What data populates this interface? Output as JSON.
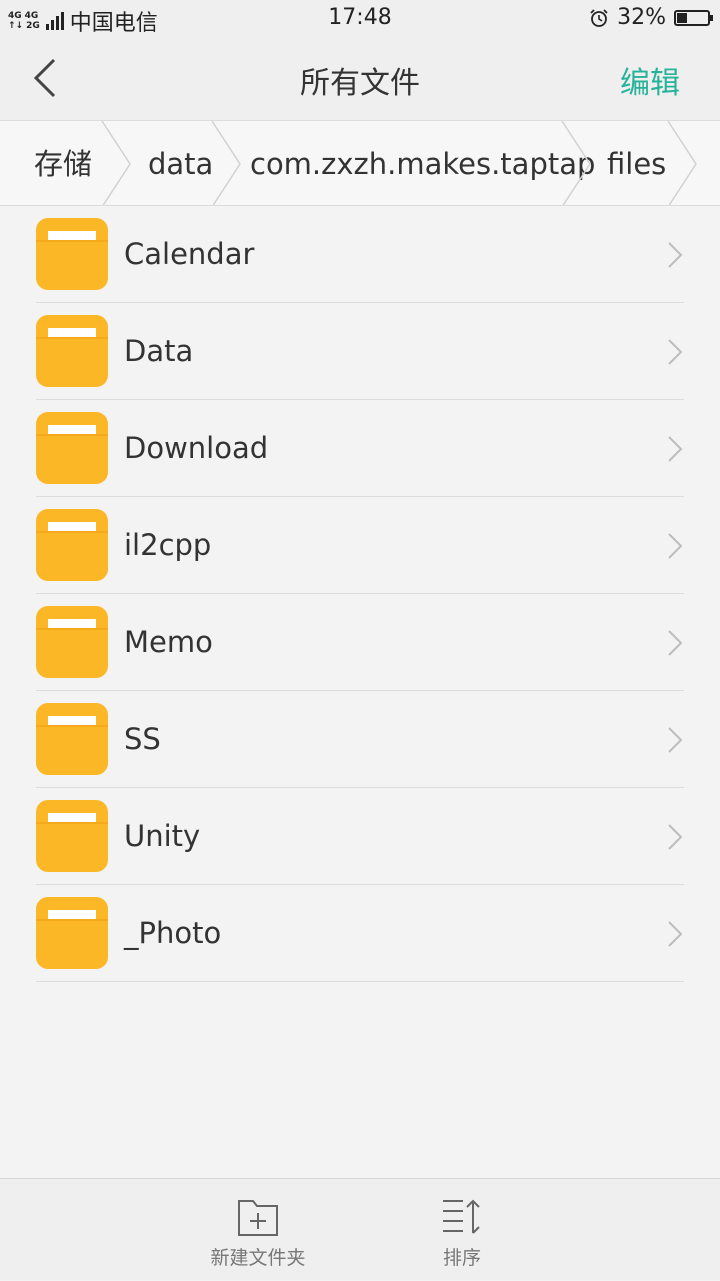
{
  "status_bar": {
    "network_top": [
      "4G",
      "4G"
    ],
    "network_bottom": [
      "↑↓",
      "2G"
    ],
    "carrier": "中国电信",
    "time": "17:48",
    "battery": "32%",
    "battery_level": 0.32
  },
  "header": {
    "title": "所有文件",
    "edit_label": "编辑",
    "back_icon": "back-arrow-icon"
  },
  "breadcrumb": [
    "存储",
    "data",
    "com.zxzh.makes.taptap",
    "files"
  ],
  "folders": [
    {
      "name": "Calendar"
    },
    {
      "name": "Data"
    },
    {
      "name": "Download"
    },
    {
      "name": "il2cpp"
    },
    {
      "name": "Memo"
    },
    {
      "name": "SS"
    },
    {
      "name": "Unity"
    },
    {
      "name": "_Photo"
    }
  ],
  "bottom_bar": {
    "new_folder_label": "新建文件夹",
    "sort_label": "排序"
  },
  "colors": {
    "accent": "#27b39a",
    "folder": "#fbb726",
    "folder_tab": "#ffffff"
  }
}
